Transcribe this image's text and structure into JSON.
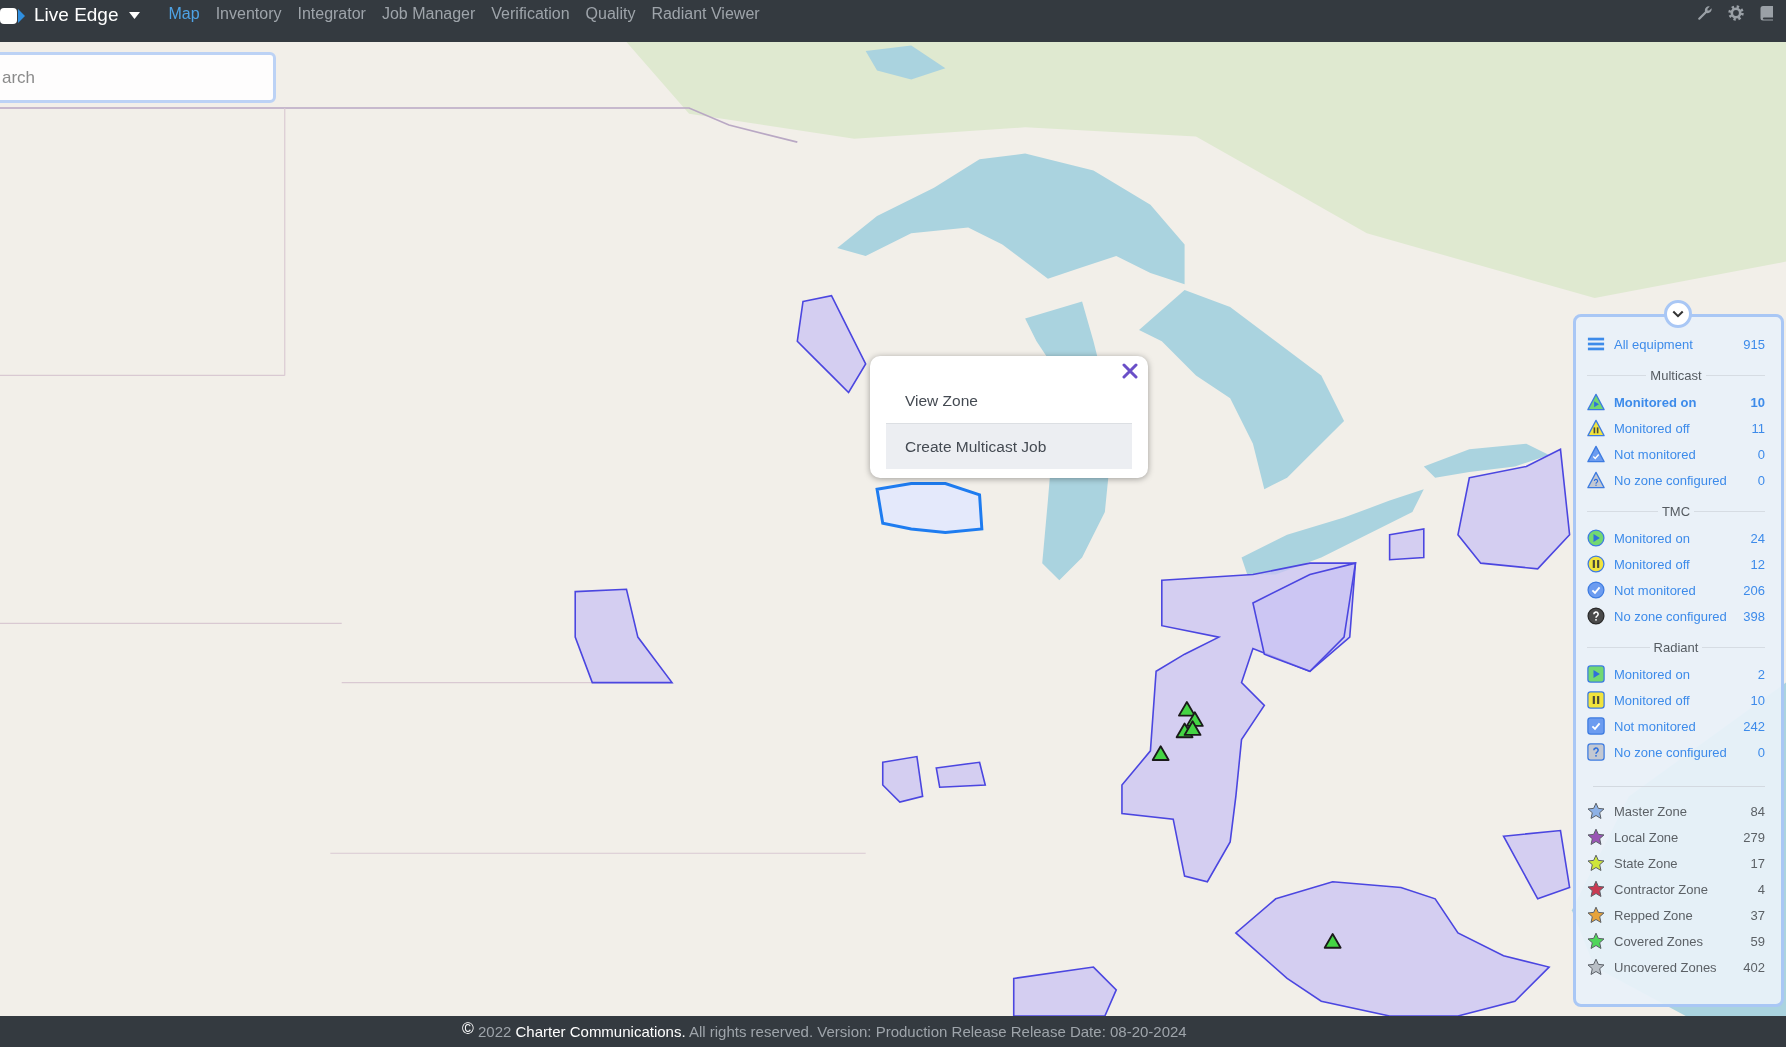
{
  "nav": {
    "brand": "Live Edge",
    "links": [
      {
        "label": "Map",
        "selected": true
      },
      {
        "label": "Inventory",
        "selected": false
      },
      {
        "label": "Integrator",
        "selected": false
      },
      {
        "label": "Job Manager",
        "selected": false
      },
      {
        "label": "Verification",
        "selected": false
      },
      {
        "label": "Quality",
        "selected": false
      },
      {
        "label": "Radiant Viewer",
        "selected": false
      }
    ]
  },
  "search": {
    "placeholder": "arch"
  },
  "popup": {
    "items": [
      {
        "label": "View Zone",
        "selected": false
      },
      {
        "label": "Create Multicast Job",
        "selected": true
      }
    ]
  },
  "legend": {
    "all_equipment": {
      "label": "All equipment",
      "count": "915"
    },
    "sections": [
      {
        "title": "Multicast",
        "kind": "triangle",
        "items": [
          {
            "kind": "on",
            "label": "Monitored on",
            "count": "10",
            "selected": true
          },
          {
            "kind": "off",
            "label": "Monitored off",
            "count": "11",
            "selected": false
          },
          {
            "kind": "not_monitored",
            "label": "Not monitored",
            "count": "0",
            "selected": false
          },
          {
            "kind": "no_zone",
            "label": "No zone configured",
            "count": "0",
            "selected": false
          }
        ]
      },
      {
        "title": "TMC",
        "kind": "circle",
        "items": [
          {
            "kind": "on",
            "label": "Monitored on",
            "count": "24",
            "selected": false
          },
          {
            "kind": "off",
            "label": "Monitored off",
            "count": "12",
            "selected": false
          },
          {
            "kind": "not_monitored",
            "label": "Not monitored",
            "count": "206",
            "selected": false
          },
          {
            "kind": "no_zone",
            "label": "No zone configured",
            "count": "398",
            "selected": false
          }
        ]
      },
      {
        "title": "Radiant",
        "kind": "square",
        "items": [
          {
            "kind": "on",
            "label": "Monitored on",
            "count": "2",
            "selected": false
          },
          {
            "kind": "off",
            "label": "Monitored off",
            "count": "10",
            "selected": false
          },
          {
            "kind": "not_monitored",
            "label": "Not monitored",
            "count": "242",
            "selected": false
          },
          {
            "kind": "no_zone",
            "label": "No zone configured",
            "count": "0",
            "selected": false
          }
        ]
      }
    ],
    "zones": [
      {
        "label": "Master Zone",
        "count": "84",
        "color": "#8db1e6"
      },
      {
        "label": "Local Zone",
        "count": "279",
        "color": "#9a55b5"
      },
      {
        "label": "State Zone",
        "count": "17",
        "color": "#cfe63b"
      },
      {
        "label": "Contractor Zone",
        "count": "4",
        "color": "#c93a52"
      },
      {
        "label": "Repped Zone",
        "count": "37",
        "color": "#e6a33a"
      },
      {
        "label": "Covered Zones",
        "count": "59",
        "color": "#4fd65a"
      },
      {
        "label": "Uncovered Zones",
        "count": "402",
        "color": "#b9bfc6"
      }
    ]
  },
  "footer": {
    "symbol": "©",
    "year": "2022",
    "company": "Charter Communications.",
    "text": "All rights reserved. Version: Production Release Release Date: 08-20-2024"
  }
}
